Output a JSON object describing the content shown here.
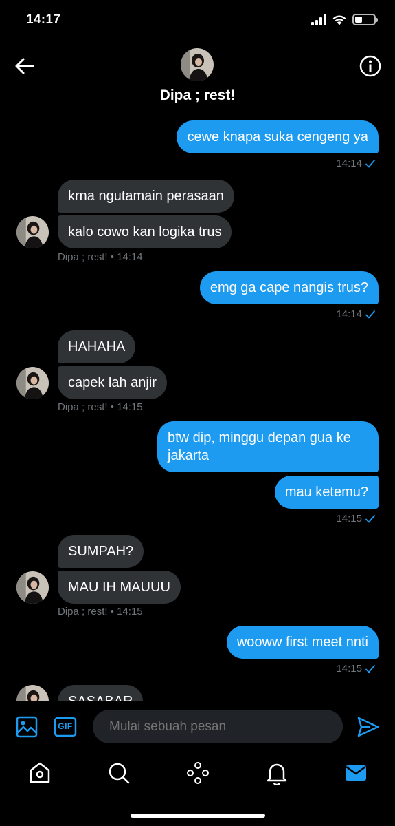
{
  "status_bar": {
    "time": "14:17",
    "battery_level_percent": 40
  },
  "header": {
    "contact_name": "Dipa ; rest!",
    "back_icon": "arrow-left-icon",
    "info_icon": "info-icon"
  },
  "messages": [
    {
      "type": "sent",
      "bubbles": [
        "cewe knapa suka cengeng ya"
      ],
      "time": "14:14",
      "status_icon": "check-icon"
    },
    {
      "type": "received",
      "bubbles": [
        "krna ngutamain perasaan",
        "kalo cowo kan logika trus"
      ],
      "meta": "Dipa ; rest! • 14:14"
    },
    {
      "type": "sent",
      "bubbles": [
        "emg ga cape nangis trus?"
      ],
      "time": "14:14",
      "status_icon": "check-icon"
    },
    {
      "type": "received",
      "bubbles": [
        "HAHAHA",
        "capek lah anjir"
      ],
      "meta": "Dipa ; rest! • 14:15"
    },
    {
      "type": "sent",
      "bubbles": [
        "btw dip, minggu depan gua ke jakarta",
        "mau ketemu?"
      ],
      "bubble_lines": [
        [
          "btw dip, minggu depan gua ke",
          "jakarta"
        ]
      ],
      "time": "14:15",
      "status_icon": "check-icon"
    },
    {
      "type": "received",
      "bubbles": [
        "SUMPAH?",
        "MAU IH MAUUU"
      ],
      "meta": "Dipa ; rest! • 14:15"
    },
    {
      "type": "sent",
      "bubbles": [
        "wooww first meet nnti"
      ],
      "time": "14:15",
      "status_icon": "check-icon"
    },
    {
      "type": "received",
      "bubbles": [
        "SASABAR"
      ]
    }
  ],
  "composer": {
    "placeholder": "Mulai sebuah pesan",
    "gif_label": "GIF",
    "image_icon": "image-icon",
    "send_icon": "send-icon"
  },
  "bottom_nav": [
    "home-icon",
    "search-icon",
    "spaces-icon",
    "notifications-icon",
    "messages-icon"
  ],
  "colors": {
    "accent": "#1d9bf0",
    "received_bubble": "#2f3336",
    "meta_text": "#71767b",
    "background": "#000000"
  }
}
